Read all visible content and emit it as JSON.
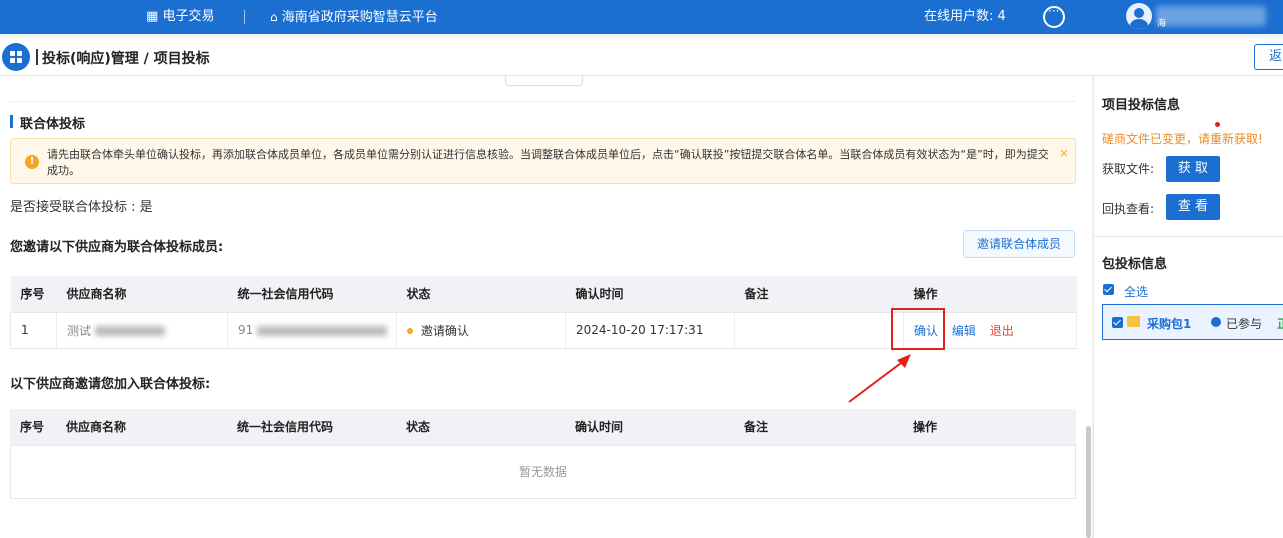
{
  "topbar": {
    "nav_trade": "电子交易",
    "nav_platform": "海南省政府采购智慧云平台",
    "online_label": "在线用户数: 4",
    "user_short": "海"
  },
  "breadcrumb": {
    "text": "投标(响应)管理 / 项目投标",
    "back_label": "返"
  },
  "section": {
    "title": "联合体投标",
    "notice": "请先由联合体牵头单位确认投标，再添加联合体成员单位，各成员单位需分别认证进行信息核验。当调整联合体成员单位后，点击“确认联投”按钮提交联合体名单。当联合体成员有效状态为“是”时，即为提交成功。",
    "accept_line": "是否接受联合体投标 : 是",
    "invited_title": "您邀请以下供应商为联合体投标成员:",
    "invite_button": "邀请联合体成员",
    "received_title": "以下供应商邀请您加入联合体投标:",
    "empty_text": "暂无数据"
  },
  "table_headers": [
    "序号",
    "供应商名称",
    "统一社会信用代码",
    "状态",
    "确认时间",
    "备注",
    "操作"
  ],
  "invited_rows": [
    {
      "index": "1",
      "name": "测试",
      "credit_code": "91",
      "status": "邀请确认",
      "time": "2024-10-20 17:17:31",
      "remark": "",
      "actions": {
        "confirm": "确认",
        "edit": "编辑",
        "exit": "退出"
      }
    }
  ],
  "right_panel": {
    "project_title": "项目投标信息",
    "warn": "磋商文件已变更，请重新获取!",
    "get_file_label": "获取文件:",
    "get_button": "获 取",
    "receipt_label": "回执查看:",
    "view_button": "查 看",
    "package_title": "包投标信息",
    "select_all": "全选",
    "package_name": "采购包1",
    "package_status": "已参与",
    "package_extra": "正"
  },
  "colors": {
    "primary": "#1b6fd1",
    "danger": "#e3231b",
    "warning": "#f5a623"
  }
}
